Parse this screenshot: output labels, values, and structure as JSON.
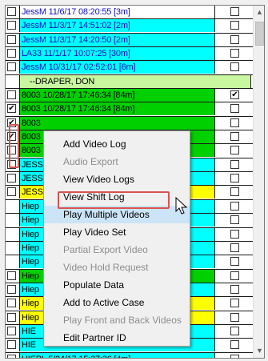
{
  "colors": {
    "cyan": "#00ffff",
    "green": "#00d000",
    "light_green": "#c8f7a0",
    "yellow": "#ffff00",
    "blue": "#0000ff",
    "white": "#ffffff",
    "menu_highlight": "#cce4f7",
    "annotation_red": "#d9534f"
  },
  "rows": [
    {
      "text": "JessM 11/6/17 08:20:55 [3m]",
      "bg": "#ffffff",
      "checked": false,
      "second_checkbox": true,
      "second_checked": false
    },
    {
      "text": "JessM 11/3/17 14:51:02 [2m]",
      "bg": "#00ffff",
      "checked": false,
      "second_checkbox": true,
      "second_checked": false
    },
    {
      "text": "JessM 11/3/17 14:20:50 [2m]",
      "bg": "#00ffff",
      "checked": false,
      "second_checkbox": true,
      "second_checked": false
    },
    {
      "text": "LA33 11/1/17 10:07:25 [30m]",
      "bg": "#00ffff",
      "checked": false,
      "second_checkbox": true,
      "second_checked": false
    },
    {
      "text": "JessM 10/31/17 02:52:01 [6m]",
      "bg": "#00ffff",
      "checked": false,
      "second_checkbox": true,
      "second_checked": false
    },
    {
      "text": "--DRAPER, DON",
      "bg": "#c8f7a0",
      "checked": null,
      "second_checkbox": false,
      "header": true
    },
    {
      "text": "8003 10/28/17 17:46:34 [84m]",
      "bg": "#00d000",
      "checked": false,
      "second_checkbox": true,
      "second_checked": true
    },
    {
      "text": "8003 10/28/17 17:46:34 [84m]",
      "bg": "#00d000",
      "checked": true,
      "second_checkbox": true,
      "second_checked": false
    },
    {
      "text": "8003",
      "bg": "#00d000",
      "checked": true,
      "second_checkbox": true,
      "second_checked": false
    },
    {
      "text": "8003",
      "bg": "#00d000",
      "checked": true,
      "second_checkbox": true,
      "second_checked": false
    },
    {
      "text": "8003",
      "bg": "#00d000",
      "checked": false,
      "second_checkbox": true,
      "second_checked": false
    },
    {
      "text": "JESS",
      "bg": "#00ffff",
      "checked": false,
      "second_checkbox": true,
      "second_checked": false
    },
    {
      "text": "JESS",
      "bg": "#00ffff",
      "checked": false,
      "second_checkbox": true,
      "second_checked": false
    },
    {
      "text": "JESS",
      "bg": "#ffff00",
      "checked": false,
      "second_checkbox": true,
      "second_checked": false
    },
    {
      "text": "Hiep",
      "bg": "#00ffff",
      "checked": null,
      "second_checkbox": true,
      "second_checked": false
    },
    {
      "text": "Hiep",
      "bg": "#00ffff",
      "checked": null,
      "second_checkbox": true,
      "second_checked": false
    },
    {
      "text": "Hiep",
      "bg": "#00ffff",
      "checked": null,
      "second_checkbox": true,
      "second_checked": false
    },
    {
      "text": "Hiep",
      "bg": "#00ffff",
      "checked": null,
      "second_checkbox": true,
      "second_checked": false
    },
    {
      "text": "Hiep",
      "bg": "#00ffff",
      "checked": null,
      "second_checkbox": true,
      "second_checked": false
    },
    {
      "text": "Hiep",
      "bg": "#00d000",
      "checked": false,
      "second_checkbox": true,
      "second_checked": false
    },
    {
      "text": "Hiep",
      "bg": "#00ffff",
      "checked": false,
      "second_checkbox": true,
      "second_checked": false
    },
    {
      "text": "Hiep",
      "bg": "#ffff00",
      "checked": false,
      "second_checkbox": true,
      "second_checked": false
    },
    {
      "text": "Hiep",
      "bg": "#ffff00",
      "checked": false,
      "second_checkbox": true,
      "second_checked": false
    },
    {
      "text": "HIE",
      "bg": "#00ffff",
      "checked": false,
      "second_checkbox": true,
      "second_checked": false
    },
    {
      "text": "HIE",
      "bg": "#00ffff",
      "checked": false,
      "second_checkbox": true,
      "second_checked": false
    },
    {
      "text": "HIEPL 5/24/17 15:37:26 [4m]",
      "bg": "#00ffff",
      "checked": false,
      "second_checkbox": true,
      "second_checked": false
    }
  ],
  "context_menu": {
    "items": [
      {
        "label": "Add Video Log",
        "enabled": true
      },
      {
        "label": "Audio Export",
        "enabled": false
      },
      {
        "label": "View Video Logs",
        "enabled": true
      },
      {
        "label": "View Shift Log",
        "enabled": true
      },
      {
        "label": "Play Multiple Videos",
        "enabled": true,
        "highlighted": true
      },
      {
        "label": "Play Video Set",
        "enabled": true
      },
      {
        "label": "Partial Export Video",
        "enabled": false
      },
      {
        "label": "Video Hold Request",
        "enabled": false
      },
      {
        "label": "Populate Data",
        "enabled": true
      },
      {
        "label": "Add to Active Case",
        "enabled": true
      },
      {
        "label": "Play Front and Back Videos",
        "enabled": false
      },
      {
        "label": "Edit Partner ID",
        "enabled": true
      }
    ]
  },
  "scrollbar": {
    "up_icon": "chevron-up-icon",
    "down_icon": "chevron-down-icon"
  }
}
